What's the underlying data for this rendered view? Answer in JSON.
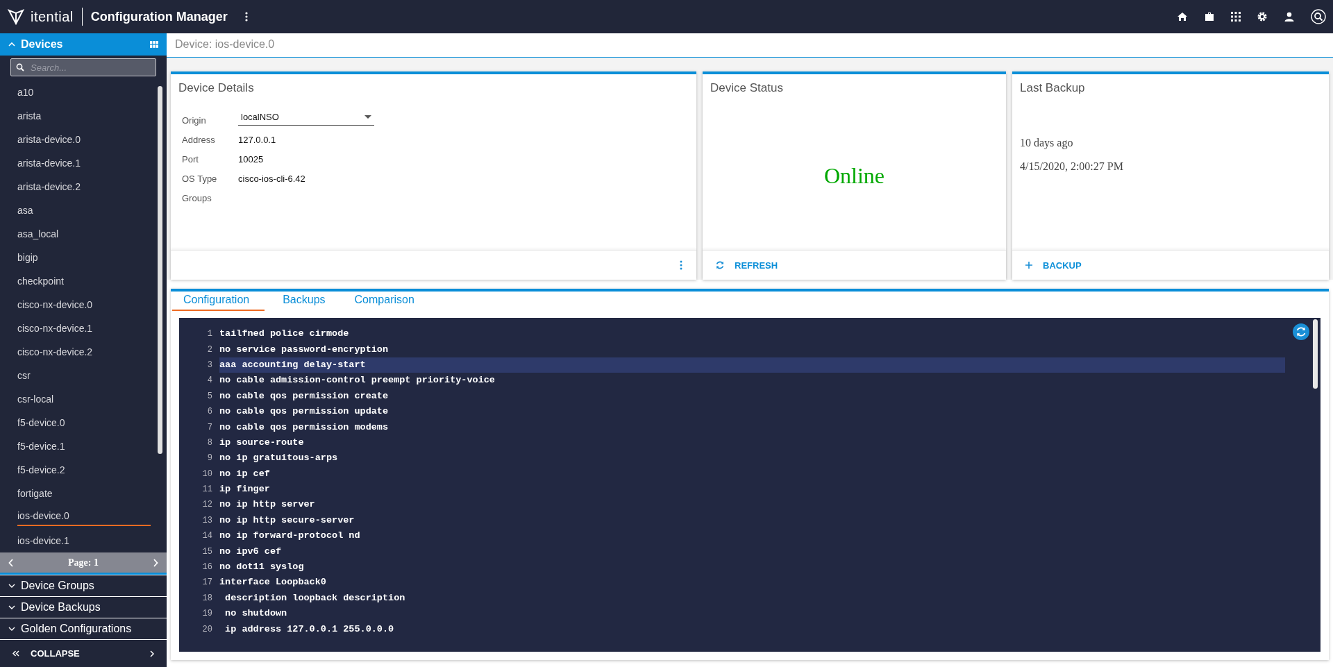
{
  "app_bar": {
    "brand": "itential",
    "title": "Configuration Manager"
  },
  "sidebar": {
    "sections": [
      {
        "label": "Devices",
        "expanded": true
      },
      {
        "label": "Device Groups",
        "expanded": false
      },
      {
        "label": "Device Backups",
        "expanded": false
      },
      {
        "label": "Golden Configurations",
        "expanded": false
      }
    ],
    "search": {
      "placeholder": "Search..."
    },
    "devices": [
      {
        "label": "a10",
        "selected": false
      },
      {
        "label": "arista",
        "selected": false
      },
      {
        "label": "arista-device.0",
        "selected": false
      },
      {
        "label": "arista-device.1",
        "selected": false
      },
      {
        "label": "arista-device.2",
        "selected": false
      },
      {
        "label": "asa",
        "selected": false
      },
      {
        "label": "asa_local",
        "selected": false
      },
      {
        "label": "bigip",
        "selected": false
      },
      {
        "label": "checkpoint",
        "selected": false
      },
      {
        "label": "cisco-nx-device.0",
        "selected": false
      },
      {
        "label": "cisco-nx-device.1",
        "selected": false
      },
      {
        "label": "cisco-nx-device.2",
        "selected": false
      },
      {
        "label": "csr",
        "selected": false
      },
      {
        "label": "csr-local",
        "selected": false
      },
      {
        "label": "f5-device.0",
        "selected": false
      },
      {
        "label": "f5-device.1",
        "selected": false
      },
      {
        "label": "f5-device.2",
        "selected": false
      },
      {
        "label": "fortigate",
        "selected": false
      },
      {
        "label": "ios-device.0",
        "selected": true
      },
      {
        "label": "ios-device.1",
        "selected": false
      }
    ],
    "pager": {
      "label": "Page: 1"
    },
    "collapse": {
      "label": "COLLAPSE"
    }
  },
  "breadcrumb": "Device: ios-device.0",
  "device_details": {
    "title": "Device Details",
    "fields": [
      {
        "kind": "select",
        "label": "Origin",
        "value": "localNSO"
      },
      {
        "kind": "text",
        "label": "Address",
        "value": "127.0.0.1"
      },
      {
        "kind": "text",
        "label": "Port",
        "value": "10025"
      },
      {
        "kind": "text",
        "label": "OS Type",
        "value": "cisco-ios-cli-6.42"
      },
      {
        "kind": "text",
        "label": "Groups"
      }
    ]
  },
  "device_status": {
    "title": "Device Status",
    "status": "Online",
    "color": "#00a800",
    "action": "REFRESH"
  },
  "last_backup": {
    "title": "Last Backup",
    "relative": "10 days ago",
    "timestamp": "4/15/2020, 2:00:27 PM",
    "action": "BACKUP"
  },
  "tabs": [
    {
      "label": "Configuration",
      "selected": true
    },
    {
      "label": "Backups",
      "selected": false
    },
    {
      "label": "Comparison",
      "selected": false
    }
  ],
  "config_lines": [
    {
      "number": "1",
      "text": "tailfned police cirmode",
      "selected": false
    },
    {
      "number": "2",
      "text": "no service password-encryption",
      "selected": false
    },
    {
      "number": "3",
      "text": "aaa accounting delay-start",
      "selected": true
    },
    {
      "number": "4",
      "text": "no cable admission-control preempt priority-voice",
      "selected": false
    },
    {
      "number": "5",
      "text": "no cable qos permission create",
      "selected": false
    },
    {
      "number": "6",
      "text": "no cable qos permission update",
      "selected": false
    },
    {
      "number": "7",
      "text": "no cable qos permission modems",
      "selected": false
    },
    {
      "number": "8",
      "text": "ip source-route",
      "selected": false
    },
    {
      "number": "9",
      "text": "no ip gratuitous-arps",
      "selected": false
    },
    {
      "number": "10",
      "text": "no ip cef",
      "selected": false
    },
    {
      "number": "11",
      "text": "ip finger",
      "selected": false
    },
    {
      "number": "12",
      "text": "no ip http server",
      "selected": false
    },
    {
      "number": "13",
      "text": "no ip http secure-server",
      "selected": false
    },
    {
      "number": "14",
      "text": "no ip forward-protocol nd",
      "selected": false
    },
    {
      "number": "15",
      "text": "no ipv6 cef",
      "selected": false
    },
    {
      "number": "16",
      "text": "no dot11 syslog",
      "selected": false
    },
    {
      "number": "17",
      "text": "interface Loopback0",
      "selected": false
    },
    {
      "number": "18",
      "text": " description loopback description",
      "selected": false
    },
    {
      "number": "19",
      "text": " no shutdown",
      "selected": false
    },
    {
      "number": "20",
      "text": " ip address 127.0.0.1 255.0.0.0",
      "selected": false
    }
  ]
}
